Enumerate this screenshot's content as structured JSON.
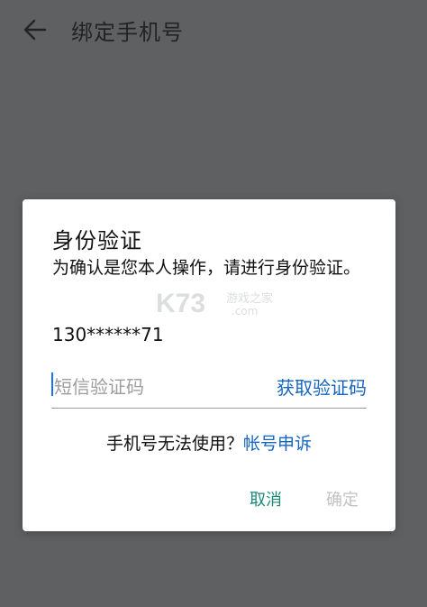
{
  "header": {
    "back_icon": "arrow-left-icon",
    "title": "绑定手机号"
  },
  "dialog": {
    "title": "身份验证",
    "description": "为确认是您本人操作，请进行身份验证。",
    "phone": "130******71",
    "code_input": {
      "placeholder": "短信验证码",
      "value": ""
    },
    "get_code_label": "获取验证码",
    "help_text": "手机号无法使用？",
    "appeal_label": "帐号申诉",
    "cancel_label": "取消",
    "confirm_label": "确定"
  },
  "watermark": {
    "text": "K73 游戏之家 .com"
  },
  "colors": {
    "backdrop": "#5f6062",
    "link_blue": "#1565c0",
    "cancel_teal": "#1a8a78",
    "disabled_gray": "#c2c2c2"
  }
}
